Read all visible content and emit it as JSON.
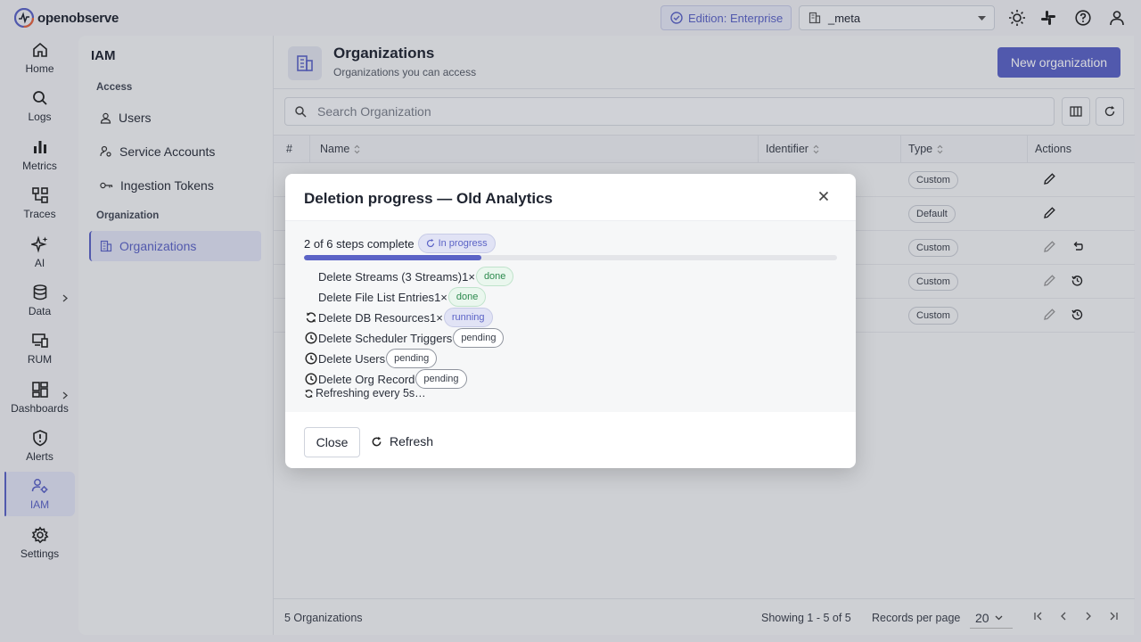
{
  "app": {
    "logo_text": "openobserve",
    "edition_label": "Edition: Enterprise",
    "org_selector_value": "_meta"
  },
  "nav": {
    "items": [
      {
        "label": "Home",
        "icon": "home-icon"
      },
      {
        "label": "Logs",
        "icon": "search-icon"
      },
      {
        "label": "Metrics",
        "icon": "bar-chart-icon"
      },
      {
        "label": "Traces",
        "icon": "traces-icon"
      },
      {
        "label": "AI",
        "icon": "sparkle-icon"
      },
      {
        "label": "Data",
        "icon": "database-icon"
      },
      {
        "label": "RUM",
        "icon": "devices-icon"
      },
      {
        "label": "Dashboards",
        "icon": "dashboard-icon"
      },
      {
        "label": "Alerts",
        "icon": "shield-alert-icon"
      },
      {
        "label": "IAM",
        "icon": "users-gear-icon"
      },
      {
        "label": "Settings",
        "icon": "gear-icon"
      }
    ],
    "active": "IAM"
  },
  "iam": {
    "title": "IAM",
    "section_access": "Access",
    "section_org": "Organization",
    "items": [
      {
        "label": "Users"
      },
      {
        "label": "Service Accounts"
      },
      {
        "label": "Ingestion Tokens"
      },
      {
        "label": "Organizations"
      }
    ]
  },
  "main": {
    "title": "Organizations",
    "subtitle": "Organizations you can access",
    "new_button": "New organization",
    "search_placeholder": "Search Organization",
    "columns": [
      "#",
      "Name",
      "Identifier",
      "Type",
      "Actions"
    ],
    "rows": [
      {
        "type": "Custom"
      },
      {
        "type": "Default"
      },
      {
        "type": "Custom"
      },
      {
        "type": "Custom"
      },
      {
        "type": "Custom"
      }
    ],
    "footer": {
      "count": "5 Organizations",
      "showing": "Showing 1 - 5 of 5",
      "rpp_label": "Records per page",
      "rpp_value": "20"
    }
  },
  "modal": {
    "title": "Deletion progress — Old Analytics",
    "summary": "2 of 6 steps complete",
    "status_chip": "In progress",
    "progress_fraction": 0.333,
    "steps": [
      {
        "label": "Delete Streams (3 Streams)",
        "count": "1×",
        "status": "done"
      },
      {
        "label": "Delete File List Entries",
        "count": "1×",
        "status": "done"
      },
      {
        "label": "Delete DB Resources",
        "count": "1×",
        "status": "running"
      },
      {
        "label": "Delete Scheduler Triggers",
        "count": "",
        "status": "pending"
      },
      {
        "label": "Delete Users",
        "count": "",
        "status": "pending"
      },
      {
        "label": "Delete Org Record",
        "count": "",
        "status": "pending"
      }
    ],
    "refreshing_text": "Refreshing every 5s…",
    "close_button": "Close",
    "refresh_button": "Refresh"
  },
  "colors": {
    "accent": "#5b63c6",
    "done": "#2d8a4e"
  }
}
